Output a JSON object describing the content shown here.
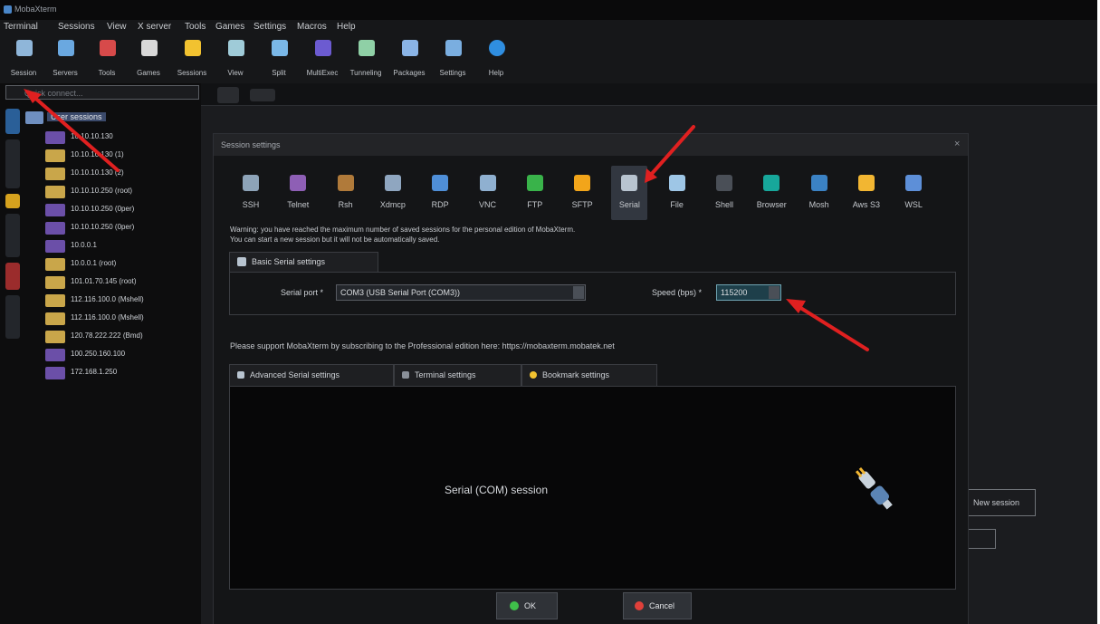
{
  "window": {
    "title": "MobaXterm"
  },
  "menu": [
    "Terminal",
    "Sessions",
    "View",
    "X server",
    "Tools",
    "Games",
    "Settings",
    "Macros",
    "Help"
  ],
  "toolbar": [
    {
      "label": "Session",
      "icon": "session-icon",
      "color": "#8fb6d9"
    },
    {
      "label": "Servers",
      "icon": "servers-icon",
      "color": "#6aa8e0"
    },
    {
      "label": "Tools",
      "icon": "tools-icon",
      "color": "#d74a4a"
    },
    {
      "label": "Games",
      "icon": "games-icon",
      "color": "#d8d8d8"
    },
    {
      "label": "Sessions",
      "icon": "star-icon",
      "color": "#f2c230"
    },
    {
      "label": "View",
      "icon": "view-icon",
      "color": "#9fcbd8"
    },
    {
      "label": "Split",
      "icon": "split-icon",
      "color": "#7ab8e8"
    },
    {
      "label": "MultiExec",
      "icon": "multiexec-icon",
      "color": "#6c5bd1"
    },
    {
      "label": "Tunneling",
      "icon": "tunneling-icon",
      "color": "#8fd0a6"
    },
    {
      "label": "Packages",
      "icon": "packages-icon",
      "color": "#8ab4e6"
    },
    {
      "label": "Settings",
      "icon": "gear-icon",
      "color": "#7aaee0"
    },
    {
      "label": "Help",
      "icon": "help-icon",
      "color": "#2f8ee0"
    }
  ],
  "sidebar": {
    "quick_connect_placeholder": "Quick connect...",
    "root_label": "User sessions",
    "items": [
      {
        "label": "10.10.10.130",
        "color": "#6b4fa8"
      },
      {
        "label": "10.10.10.130 (1)",
        "color": "#c9a64a"
      },
      {
        "label": "10.10.10.130 (2)",
        "color": "#c9a64a"
      },
      {
        "label": "10.10.10.250 (root)",
        "color": "#c9a64a"
      },
      {
        "label": "10.10.10.250 (0per)",
        "color": "#6b4fa8"
      },
      {
        "label": "10.10.10.250 (0per)",
        "color": "#6b4fa8"
      },
      {
        "label": "10.0.0.1",
        "color": "#6b4fa8"
      },
      {
        "label": "10.0.0.1 (root)",
        "color": "#c9a64a"
      },
      {
        "label": "101.01.70.145 (root)",
        "color": "#c9a64a"
      },
      {
        "label": "112.116.100.0 (Mshell)",
        "color": "#c9a64a"
      },
      {
        "label": "112.116.100.0 (Mshell)",
        "color": "#c9a64a"
      },
      {
        "label": "120.78.222.222 (Bmd)",
        "color": "#c9a64a"
      },
      {
        "label": "100.250.160.100",
        "color": "#6b4fa8"
      },
      {
        "label": "172.168.1.250",
        "color": "#6b4fa8"
      }
    ]
  },
  "dialog": {
    "title": "Session settings",
    "session_types": [
      {
        "label": "SSH",
        "icon": "ssh-icon",
        "color": "#8da3b8"
      },
      {
        "label": "Telnet",
        "icon": "telnet-icon",
        "color": "#8e5fb5"
      },
      {
        "label": "Rsh",
        "icon": "rsh-icon",
        "color": "#b07a3a"
      },
      {
        "label": "Xdmcp",
        "icon": "xdmcp-icon",
        "color": "#8fa6c0"
      },
      {
        "label": "RDP",
        "icon": "rdp-icon",
        "color": "#4f8fd8"
      },
      {
        "label": "VNC",
        "icon": "vnc-icon",
        "color": "#8fb0d0"
      },
      {
        "label": "FTP",
        "icon": "ftp-icon",
        "color": "#39b34a"
      },
      {
        "label": "SFTP",
        "icon": "sftp-icon",
        "color": "#f2a51a"
      },
      {
        "label": "Serial",
        "icon": "serial-icon",
        "color": "#b8c4d0"
      },
      {
        "label": "File",
        "icon": "file-icon",
        "color": "#9ec6e6"
      },
      {
        "label": "Shell",
        "icon": "shell-icon",
        "color": "#4a4f57"
      },
      {
        "label": "Browser",
        "icon": "browser-icon",
        "color": "#17a79b"
      },
      {
        "label": "Mosh",
        "icon": "mosh-icon",
        "color": "#3b82c4"
      },
      {
        "label": "Aws S3",
        "icon": "aws-s3-icon",
        "color": "#f2b632"
      },
      {
        "label": "WSL",
        "icon": "wsl-icon",
        "color": "#5d8fd8"
      }
    ],
    "active_type": "Serial",
    "warning_line1": "Warning: you have reached the maximum number of saved sessions for the personal edition of MobaXterm.",
    "warning_line2": "You can start a new session but it will not be automatically saved.",
    "basic_tab": "Basic Serial settings",
    "serial_port_label": "Serial port *",
    "serial_port_value": "COM3  (USB Serial Port (COM3))",
    "speed_label": "Speed (bps) *",
    "speed_value": "115200",
    "support_text": "Please support MobaXterm by subscribing to the Professional edition here: https://mobaxterm.mobatek.net",
    "lower_tabs": [
      "Advanced Serial settings",
      "Terminal settings",
      "Bookmark settings"
    ],
    "session_caption": "Serial (COM) session",
    "ok_label": "OK",
    "cancel_label": "Cancel"
  },
  "background": {
    "new_session_button": "New session"
  },
  "colors": {
    "annotation_arrow": "#e02020",
    "accent": "#2f6fb0"
  }
}
